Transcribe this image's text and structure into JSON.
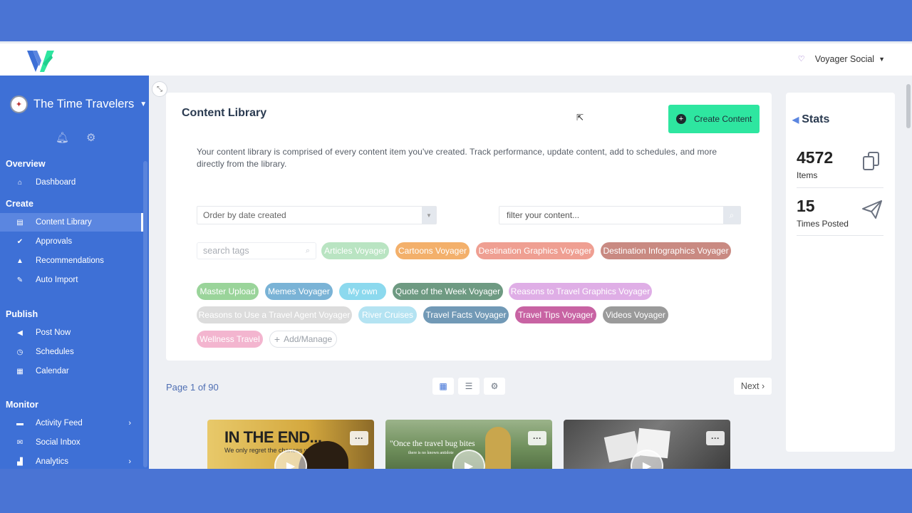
{
  "topbar": {
    "user_name": "Voyager Social"
  },
  "sidebar": {
    "brand": "The Time Travelers",
    "sections": [
      {
        "title": "Overview",
        "items": [
          {
            "label": "Dashboard",
            "icon": "home-icon"
          }
        ]
      },
      {
        "title": "Create",
        "items": [
          {
            "label": "Content Library",
            "icon": "book-icon",
            "active": true
          },
          {
            "label": "Approvals",
            "icon": "check-circle-icon"
          },
          {
            "label": "Recommendations",
            "icon": "flask-icon"
          },
          {
            "label": "Auto Import",
            "icon": "wand-icon"
          }
        ]
      },
      {
        "title": "Publish",
        "items": [
          {
            "label": "Post Now",
            "icon": "megaphone-icon"
          },
          {
            "label": "Schedules",
            "icon": "clock-icon"
          },
          {
            "label": "Calendar",
            "icon": "calendar-icon"
          }
        ]
      },
      {
        "title": "Monitor",
        "items": [
          {
            "label": "Activity Feed",
            "icon": "list-icon"
          },
          {
            "label": "Social Inbox",
            "icon": "envelope-icon"
          },
          {
            "label": "Analytics",
            "icon": "chart-icon"
          }
        ]
      }
    ]
  },
  "library": {
    "title": "Content Library",
    "create_label": "Create Content",
    "description": "Your content library is comprised of every content item you've created. Track performance, update content, add to schedules, and more directly from the library.",
    "order_value": "Order by date created",
    "filter_placeholder": "filter your content...",
    "tag_search_placeholder": "search tags",
    "add_manage_label": "Add/Manage",
    "tags": [
      {
        "label": "Articles Voyager",
        "color": "#b9e4c2"
      },
      {
        "label": "Cartoons Voyager",
        "color": "#f3b06b"
      },
      {
        "label": "Destination Graphics Voyager",
        "color": "#ef9f92"
      },
      {
        "label": "Destination Infographics Voyager",
        "color": "#c98a82"
      },
      {
        "label": "Master Upload",
        "color": "#9ad49a"
      },
      {
        "label": "Memes Voyager",
        "color": "#7ab3d6"
      },
      {
        "label": "My own",
        "color": "#8cd9ee"
      },
      {
        "label": "Quote of the Week Voyager",
        "color": "#6e9a82"
      },
      {
        "label": "Reasons to Travel Graphics Voyager",
        "color": "#dfaee6"
      },
      {
        "label": "Reasons to Use a Travel Agent Voyager",
        "color": "#dcdcdc"
      },
      {
        "label": "River Cruises",
        "color": "#b4e3f2"
      },
      {
        "label": "Travel Facts Voyager",
        "color": "#7199b6"
      },
      {
        "label": "Travel Tips Voyager",
        "color": "#c863a3"
      },
      {
        "label": "Videos Voyager",
        "color": "#9a9a9a"
      },
      {
        "label": "Wellness Travel",
        "color": "#f3b5cf"
      }
    ]
  },
  "pager": {
    "page_info": "Page 1 of 90",
    "next_label": "Next"
  },
  "thumbs": {
    "t1_head": "IN THE END...",
    "t1_sub": "We only regret the chances we didn't take",
    "t2_quote": "\"Once the travel bug bites",
    "t2_quote2": "there is no known antidote"
  },
  "stats": {
    "title": "Stats",
    "items_count": "4572",
    "items_label": "Items",
    "posted_count": "15",
    "posted_label": "Times Posted"
  }
}
